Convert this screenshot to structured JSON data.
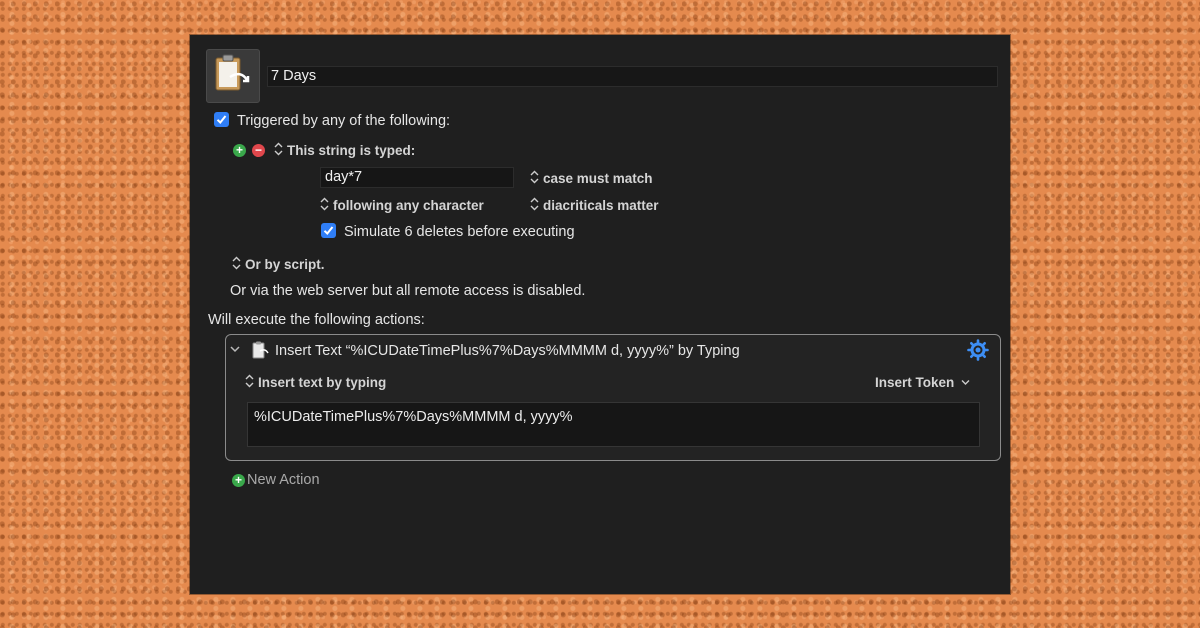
{
  "macro": {
    "name": "7 Days",
    "icon": "clipboard-insert-icon"
  },
  "trigger": {
    "header": "Triggered by any of the following:",
    "header_checked": true,
    "type_label": "This string is typed:",
    "string_value": "day*7",
    "case_option": "case must match",
    "following_option": "following any character",
    "diacriticals_option": "diacriticals matter",
    "simulate_label": "Simulate 6 deletes before executing",
    "simulate_checked": true,
    "script_label": "Or by script.",
    "web_server_text": "Or via the web server but all remote access is disabled."
  },
  "actions": {
    "header": "Will execute the following actions:",
    "items": [
      {
        "title": "Insert Text “%ICUDateTimePlus%7%Days%MMMM d, yyyy%” by Typing",
        "mode": "Insert text by typing",
        "token_menu": "Insert Token",
        "text": "%ICUDateTimePlus%7%Days%MMMM d, yyyy%"
      }
    ],
    "new_action_label": "New Action"
  },
  "colors": {
    "accent_blue": "#2f7ef6",
    "add_green": "#3aa84b",
    "remove_red": "#e0474c",
    "window_bg": "#1f1f1f",
    "cork": "#e58a4e"
  }
}
